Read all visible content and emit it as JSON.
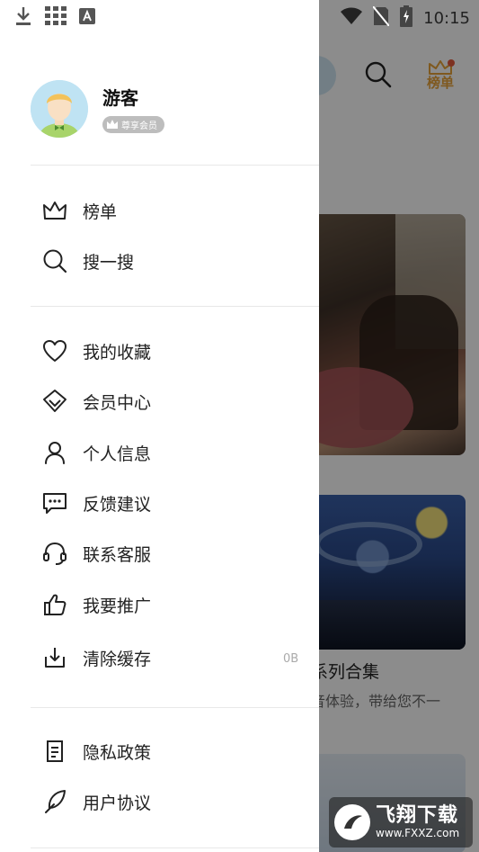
{
  "status_bar": {
    "time": "10:15",
    "icons": [
      "download-icon",
      "grid-apps-icon",
      "font-a-icon",
      "wifi-icon",
      "no-sim-icon",
      "battery-charging-icon"
    ]
  },
  "background_app": {
    "rank_label": "榜单",
    "card2_title": "系列合集",
    "card2_desc_line1": "音体验，带给您不一",
    "card2_desc_line2": "。",
    "accent_color": "#e8a23a"
  },
  "drawer": {
    "profile": {
      "name": "游客",
      "vip_badge": "尊享会员"
    },
    "section1": [
      {
        "label": "榜单",
        "icon": "crown-icon"
      },
      {
        "label": "搜一搜",
        "icon": "search-icon"
      }
    ],
    "section2": [
      {
        "label": "我的收藏",
        "icon": "heart-icon"
      },
      {
        "label": "会员中心",
        "icon": "diamond-icon"
      },
      {
        "label": "个人信息",
        "icon": "person-icon"
      },
      {
        "label": "反馈建议",
        "icon": "chat-bubble-icon"
      },
      {
        "label": "联系客服",
        "icon": "headset-icon"
      },
      {
        "label": "我要推广",
        "icon": "thumbs-up-icon"
      },
      {
        "label": "清除缓存",
        "icon": "download-tray-icon"
      }
    ],
    "cache_size": "0B",
    "section3": [
      {
        "label": "隐私政策",
        "icon": "document-icon"
      },
      {
        "label": "用户协议",
        "icon": "feather-icon"
      }
    ]
  },
  "watermark": {
    "title": "飞翔下载",
    "url": "www.FXXZ.com"
  }
}
